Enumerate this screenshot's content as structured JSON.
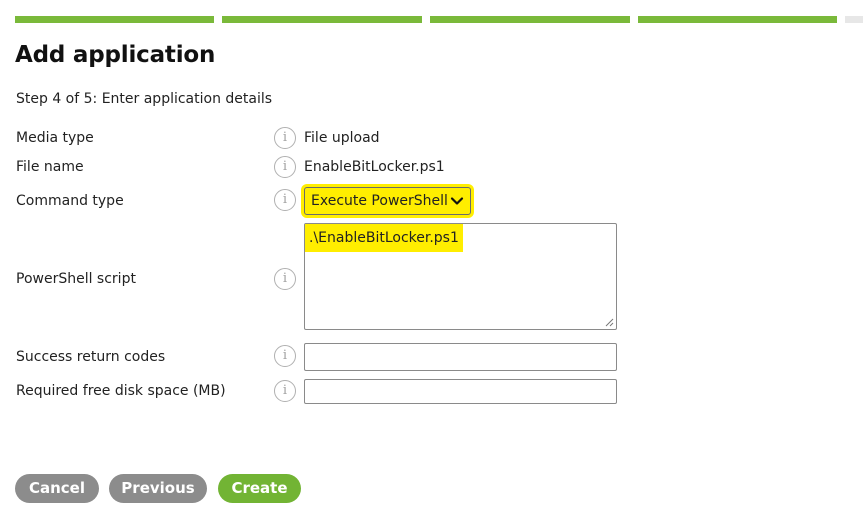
{
  "wizard": {
    "title": "Add application",
    "step_text": "Step 4 of 5: Enter application details",
    "progress": {
      "total_steps": 5,
      "completed_steps": 4,
      "color_done": "#7ab93a",
      "color_todo": "#e7e7e7"
    }
  },
  "form": {
    "media_type": {
      "label": "Media type",
      "value": "File upload",
      "info_icon": "info-icon"
    },
    "file_name": {
      "label": "File name",
      "value": "EnableBitLocker.ps1",
      "info_icon": "info-icon"
    },
    "command_type": {
      "label": "Command type",
      "selected": "Execute PowerShell",
      "info_icon": "info-icon",
      "highlight_color": "#ffee00"
    },
    "powershell_script": {
      "label": "PowerShell script",
      "value": ".\\EnableBitLocker.ps1",
      "info_icon": "info-icon"
    },
    "success_return_codes": {
      "label": "Success return codes",
      "value": "",
      "info_icon": "info-icon"
    },
    "required_disk_space": {
      "label": "Required free disk space (MB)",
      "value": "",
      "info_icon": "info-icon"
    }
  },
  "buttons": {
    "cancel": "Cancel",
    "previous": "Previous",
    "create": "Create",
    "primary_color": "#72b434",
    "secondary_color": "#8c8c8c"
  },
  "icons": {
    "info": "i"
  }
}
